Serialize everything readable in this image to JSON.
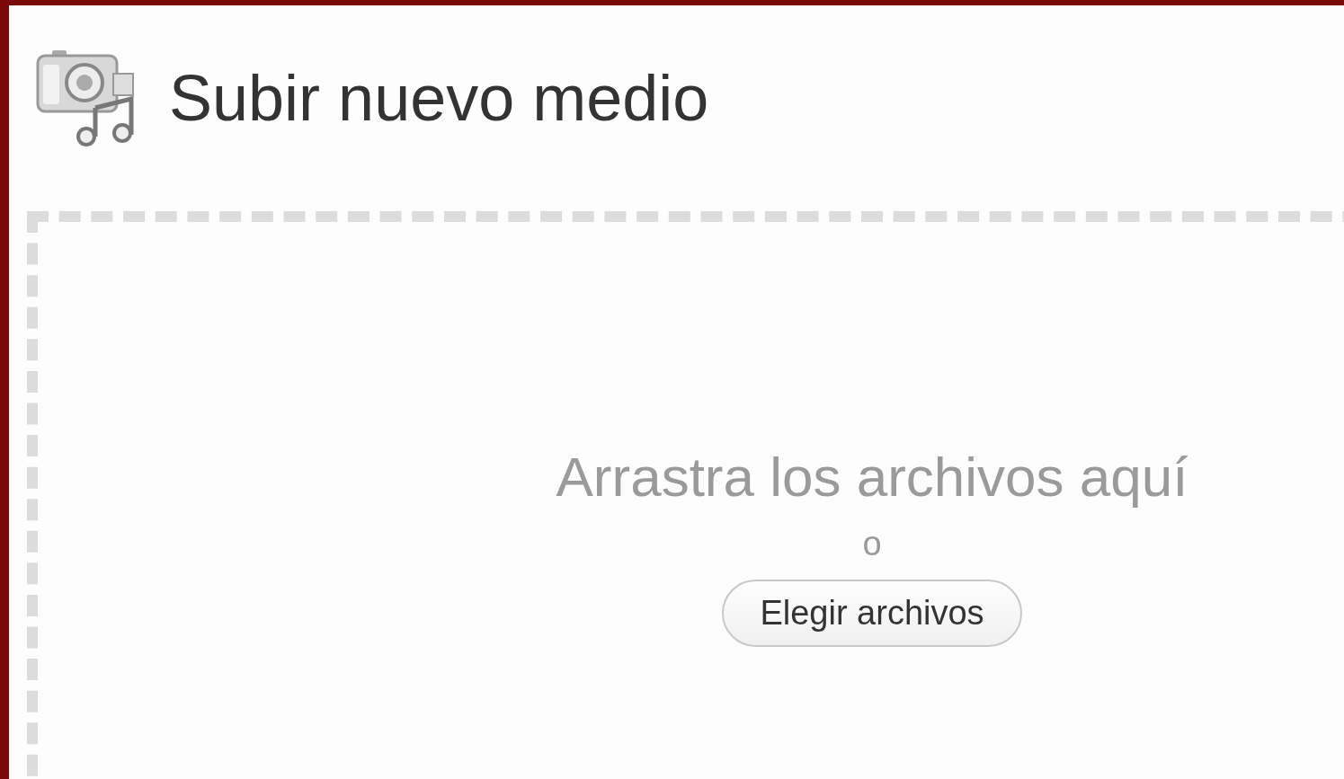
{
  "page": {
    "title": "Subir nuevo medio"
  },
  "upload_area": {
    "instructions": "Arrastra los archivos aquí",
    "separator": "o",
    "button": "Elegir archivos"
  }
}
